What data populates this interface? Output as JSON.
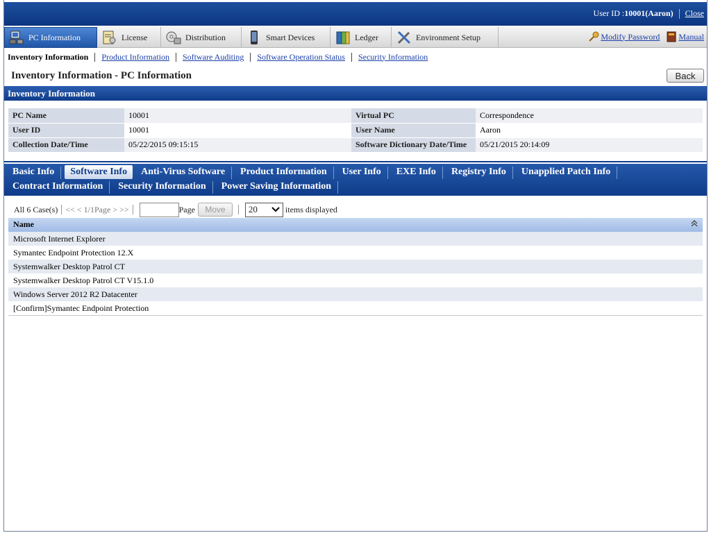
{
  "header": {
    "user_label": "User ID : ",
    "user_value": "10001(Aaron)",
    "close_label": "Close"
  },
  "mainnav": {
    "tabs": [
      {
        "label": "PC Information",
        "icon": "pc-icon"
      },
      {
        "label": "License",
        "icon": "license-icon"
      },
      {
        "label": "Distribution",
        "icon": "distribution-icon"
      },
      {
        "label": "Smart Devices",
        "icon": "smart-device-icon"
      },
      {
        "label": "Ledger",
        "icon": "ledger-icon"
      },
      {
        "label": "Environment Setup",
        "icon": "tools-icon"
      }
    ],
    "modify_password": "Modify Password",
    "manual": "Manual"
  },
  "subnav": {
    "items": [
      "Inventory Information",
      "Product Information",
      "Software Auditing",
      "Software Operation Status",
      "Security Information"
    ]
  },
  "page": {
    "title": "Inventory Information - PC Information",
    "back_label": "Back",
    "section_title": "Inventory Information"
  },
  "info": {
    "rows": [
      {
        "l1": "PC Name",
        "v1": "10001",
        "l2": "Virtual PC",
        "v2": "Correspondence"
      },
      {
        "l1": "User ID",
        "v1": "10001",
        "l2": "User Name",
        "v2": "Aaron"
      },
      {
        "l1": "Collection Date/Time",
        "v1": "05/22/2015 09:15:15",
        "l2": "Software Dictionary Date/Time",
        "v2": "05/21/2015 20:14:09"
      }
    ]
  },
  "subtabs": {
    "row1": [
      "Basic Info",
      "Software Info",
      "Anti-Virus Software",
      "Product Information",
      "User Info",
      "EXE Info",
      "Registry Info",
      "Unapplied Patch Info"
    ],
    "row2": [
      "Contract Information",
      "Security Information",
      "Power Saving Information"
    ]
  },
  "pager": {
    "count": "All 6 Case(s)",
    "nav": "<< < 1/1Page > >>",
    "page_label": "Page",
    "move_label": "Move",
    "page_value": "",
    "per_page": "20",
    "items_displayed": "items displayed"
  },
  "list": {
    "header": "Name",
    "rows": [
      "Microsoft Internet Explorer",
      "Symantec Endpoint Protection 12.X",
      "Systemwalker Desktop Patrol CT",
      "Systemwalker Desktop Patrol CT V15.1.0",
      "Windows Server 2012 R2 Datacenter",
      "[Confirm]Symantec Endpoint Protection"
    ]
  },
  "colors": {
    "header_blue": "#0d3580",
    "link_blue": "#1a3fa8",
    "label_bg": "#d5dbe6",
    "list_head": "#9fbbe6"
  }
}
